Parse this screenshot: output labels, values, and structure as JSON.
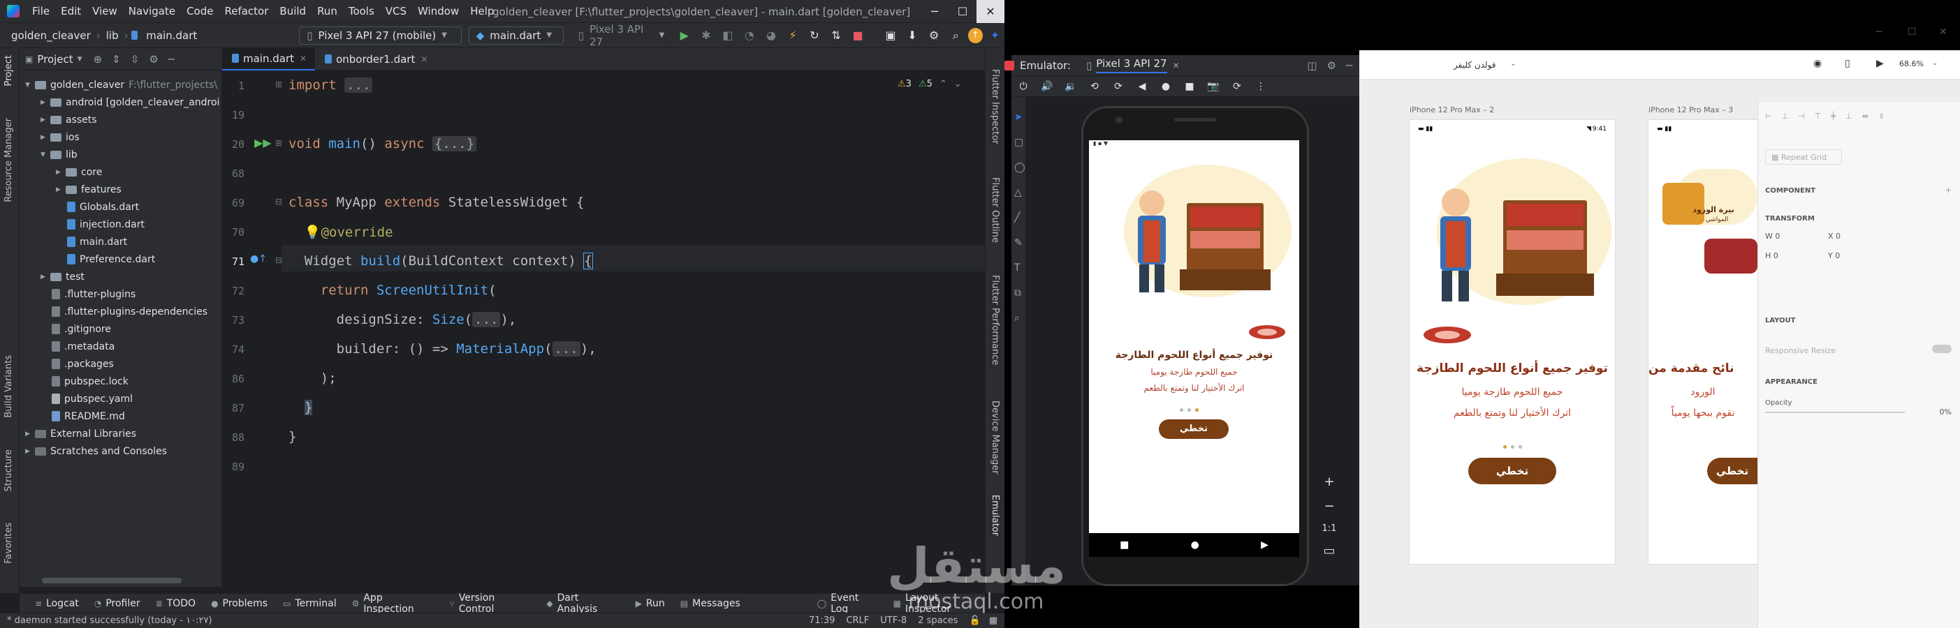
{
  "ide": {
    "menu": [
      "File",
      "Edit",
      "View",
      "Navigate",
      "Code",
      "Refactor",
      "Build",
      "Run",
      "Tools",
      "VCS",
      "Window",
      "Help"
    ],
    "window_title": "golden_cleaver [F:\\flutter_projects\\golden_cleaver] - main.dart [golden_cleaver]",
    "breadcrumb": [
      "golden_cleaver",
      "lib",
      "main.dart"
    ],
    "device_combo": "Pixel 3 API 27 (mobile)",
    "run_config": "main.dart",
    "emulator_combo": "Pixel 3 API 27",
    "project_header": "Project",
    "tree": [
      {
        "label": "golden_cleaver",
        "extra": "F:\\flutter_projects\\",
        "type": "folder",
        "indent": 0,
        "open": true
      },
      {
        "label": "android [golden_cleaver_androi",
        "type": "folder",
        "indent": 1,
        "open": false
      },
      {
        "label": "assets",
        "type": "folder",
        "indent": 1,
        "open": false
      },
      {
        "label": "ios",
        "type": "folder",
        "indent": 1,
        "open": false
      },
      {
        "label": "lib",
        "type": "folder",
        "indent": 1,
        "open": true
      },
      {
        "label": "core",
        "type": "folder",
        "indent": 2,
        "open": false
      },
      {
        "label": "features",
        "type": "folder",
        "indent": 2,
        "open": false
      },
      {
        "label": "Globals.dart",
        "type": "file",
        "indent": 2
      },
      {
        "label": "injection.dart",
        "type": "file",
        "indent": 2
      },
      {
        "label": "main.dart",
        "type": "file",
        "indent": 2
      },
      {
        "label": "Preference.dart",
        "type": "file",
        "indent": 2
      },
      {
        "label": "test",
        "type": "folder",
        "indent": 1,
        "open": false
      },
      {
        "label": ".flutter-plugins",
        "type": "gfile",
        "indent": 1
      },
      {
        "label": ".flutter-plugins-dependencies",
        "type": "gfile",
        "indent": 1
      },
      {
        "label": ".gitignore",
        "type": "gfile",
        "indent": 1
      },
      {
        "label": ".metadata",
        "type": "gfile",
        "indent": 1
      },
      {
        "label": ".packages",
        "type": "gfile",
        "indent": 1
      },
      {
        "label": "pubspec.lock",
        "type": "gfile",
        "indent": 1
      },
      {
        "label": "pubspec.yaml",
        "type": "yfile",
        "indent": 1
      },
      {
        "label": "README.md",
        "type": "mdfile",
        "indent": 1
      },
      {
        "label": "External Libraries",
        "type": "lib",
        "indent": 0
      },
      {
        "label": "Scratches and Consoles",
        "type": "lib",
        "indent": 0
      }
    ],
    "tabs": [
      "main.dart",
      "onborder1.dart"
    ],
    "line_numbers": [
      "1",
      "19",
      "20",
      "68",
      "69",
      "70",
      "71",
      "72",
      "73",
      "74",
      "86",
      "87",
      "88",
      "89"
    ],
    "warnings": {
      "warn": "3",
      "weak": "5"
    },
    "left_strip": [
      "Project",
      "Resource Manager",
      "Build Variants",
      "Structure",
      "Favorites"
    ],
    "right_strip": [
      "Flutter Inspector",
      "Flutter Outline",
      "Flutter Performance",
      "Device Manager",
      "Emulator"
    ],
    "bottom_tools": [
      "Logcat",
      "Profiler",
      "TODO",
      "Problems",
      "Terminal",
      "App Inspection",
      "Version Control",
      "Dart Analysis",
      "Run",
      "Messages"
    ],
    "bottom_right": [
      "Event Log",
      "Layout Inspector"
    ],
    "status": {
      "message": "* daemon started successfully (today - ١٠:٢٧)",
      "pos": "71:39",
      "eol": "CRLF",
      "enc": "UTF-8",
      "indent": "2 spaces"
    }
  },
  "emulator": {
    "header_label": "Emulator:",
    "device_tab": "Pixel 3 API 27",
    "app": {
      "title": "توفير جميع أنواع اللحوم الطازجة",
      "line1": "جميع اللحوم طازجة يوميا",
      "line2": "اترك الأختيار لنا وتمتع بالطعم",
      "button": "تخطي"
    },
    "zoom_ratio": "1:1"
  },
  "xd": {
    "file_title": "قولدن كليفر",
    "zoom": "68.6%",
    "artboard2_label": "iPhone 12 Pro Max – 2",
    "artboard3_label": "iPhone 12 Pro Max – 3",
    "art2": {
      "time": "9:41",
      "title": "توفير جميع أنواع اللحوم الطازجة",
      "line1": "جميع اللحوم طازجة يوميا",
      "line2": "اترك الأختيار لنا وتمتع بالطعم",
      "button": "تخطي"
    },
    "art3": {
      "title_partial": "نائح مقدمة من",
      "brand1": "بيرة الورود",
      "brand2": "المواشي",
      "line1": "الورود",
      "line2": "نقوم ببحها يومياً",
      "button": "تخطي"
    },
    "panel": {
      "repeat_grid": "Repeat Grid",
      "component": "COMPONENT",
      "transform": "TRANSFORM",
      "w_label": "W",
      "w_val": "0",
      "x_label": "X",
      "x_val": "0",
      "h_label": "H",
      "h_val": "0",
      "y_label": "Y",
      "y_val": "0",
      "layout": "LAYOUT",
      "responsive": "Responsive Resize",
      "appearance": "APPEARANCE",
      "opacity": "Opacity",
      "opacity_val": "0%"
    }
  },
  "watermark": {
    "ar": "مستقل",
    "en": "mostaql.com"
  }
}
